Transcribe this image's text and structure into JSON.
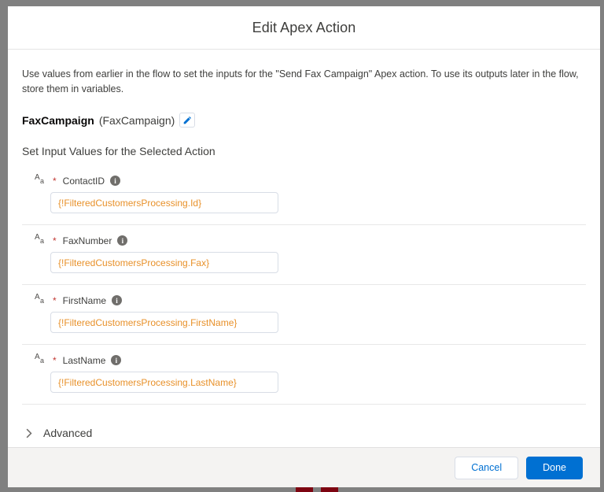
{
  "header": {
    "title": "Edit Apex Action"
  },
  "body": {
    "intro": "Use values from earlier in the flow to set the inputs for the \"Send Fax Campaign\" Apex action. To use its outputs later in the flow, store them in variables.",
    "action": {
      "name": "FaxCampaign",
      "label": "(FaxCampaign)",
      "edit_icon": "pencil-icon"
    },
    "section_title": "Set Input Values for the Selected Action",
    "fields": [
      {
        "type_icon": "text-datatype-icon",
        "type_icon_upper": "A",
        "type_icon_lower": "a",
        "required_marker": "*",
        "label": "ContactID",
        "info_icon": "info-icon",
        "info_glyph": "i",
        "value": "{!FilteredCustomersProcessing.Id}"
      },
      {
        "type_icon": "text-datatype-icon",
        "type_icon_upper": "A",
        "type_icon_lower": "a",
        "required_marker": "*",
        "label": "FaxNumber",
        "info_icon": "info-icon",
        "info_glyph": "i",
        "value": "{!FilteredCustomersProcessing.Fax}"
      },
      {
        "type_icon": "text-datatype-icon",
        "type_icon_upper": "A",
        "type_icon_lower": "a",
        "required_marker": "*",
        "label": "FirstName",
        "info_icon": "info-icon",
        "info_glyph": "i",
        "value": "{!FilteredCustomersProcessing.FirstName}"
      },
      {
        "type_icon": "text-datatype-icon",
        "type_icon_upper": "A",
        "type_icon_lower": "a",
        "required_marker": "*",
        "label": "LastName",
        "info_icon": "info-icon",
        "info_glyph": "i",
        "value": "{!FilteredCustomersProcessing.LastName}"
      }
    ],
    "advanced": {
      "label": "Advanced",
      "chevron_icon": "chevron-right-icon",
      "expanded": false
    }
  },
  "footer": {
    "cancel_label": "Cancel",
    "done_label": "Done"
  },
  "colors": {
    "brand_blue": "#0070d2",
    "merge_field_orange": "#e8912a",
    "required_red": "#c23934",
    "text_primary": "#3e3e3c",
    "footer_bg": "#f4f3f2",
    "backdrop_gray": "#808080"
  }
}
